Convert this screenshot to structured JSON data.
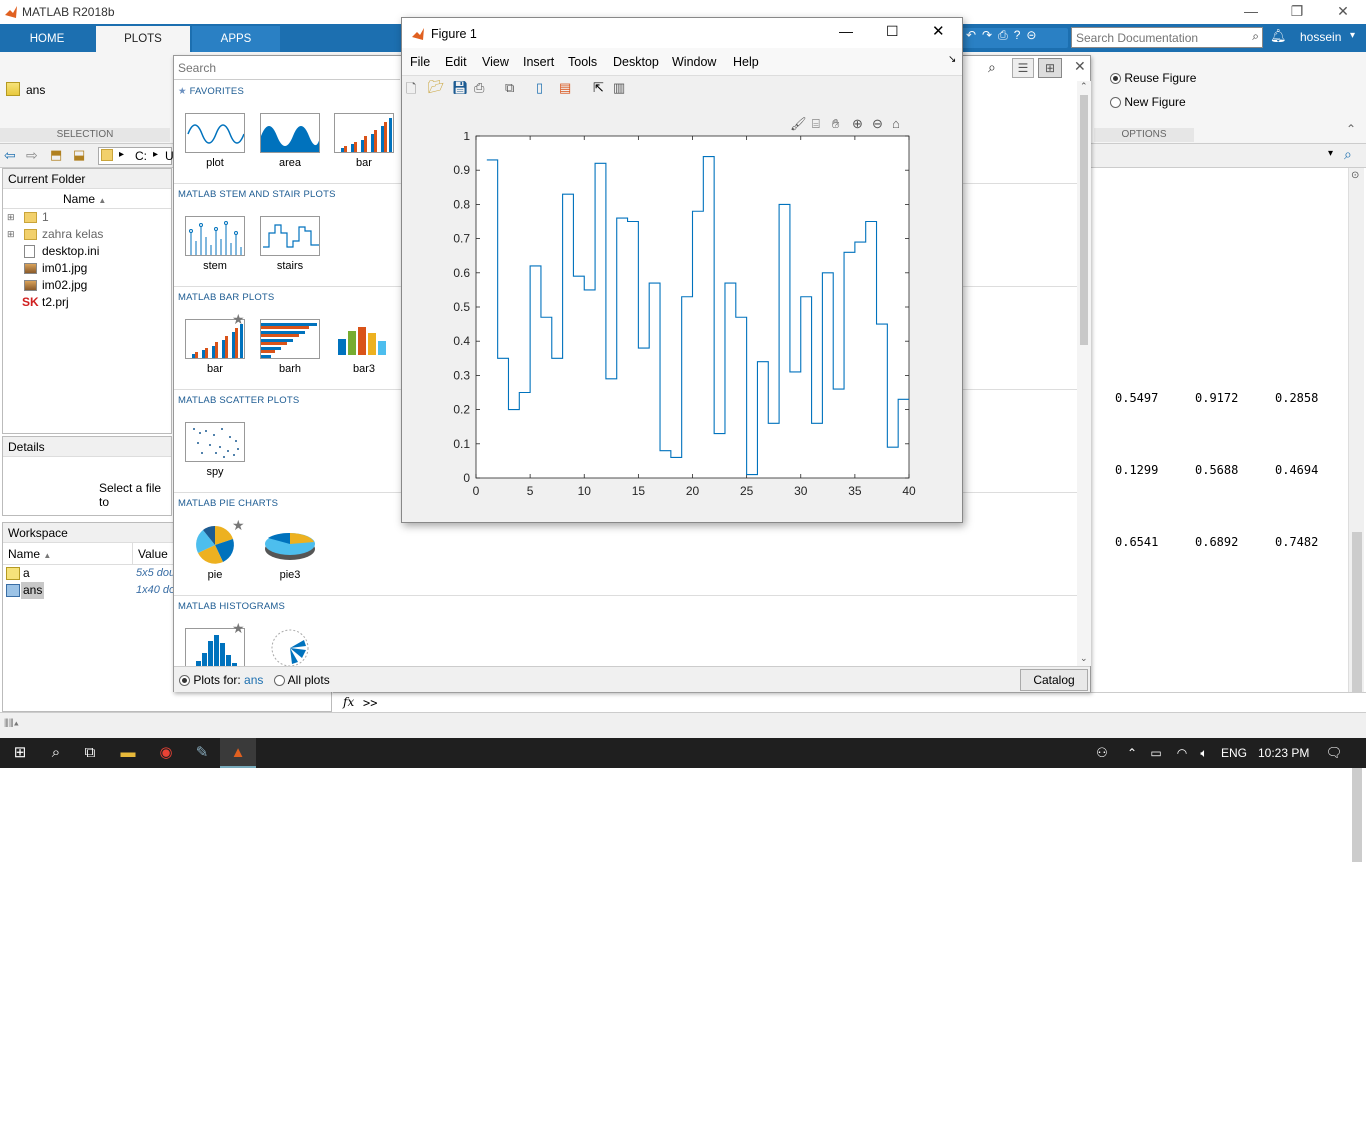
{
  "app": {
    "title": "MATLAB R2018b"
  },
  "tabs": [
    "HOME",
    "PLOTS",
    "APPS"
  ],
  "ribbon": {
    "selection_var": "ans",
    "selection_label": "SELECTION",
    "options_label": "OPTIONS",
    "reuse_figure": "Reuse Figure",
    "new_figure": "New Figure",
    "search_placeholder": "Search Documentation",
    "user": "hossein"
  },
  "path": {
    "drive": "C:",
    "rest": "U"
  },
  "current_folder": {
    "title": "Current Folder",
    "column": "Name",
    "items": [
      "1",
      "zahra kelas",
      "desktop.ini",
      "im01.jpg",
      "im02.jpg",
      "t2.prj"
    ]
  },
  "details": {
    "title": "Details",
    "text": "Select a file to"
  },
  "workspace": {
    "title": "Workspace",
    "col_name": "Name",
    "col_value": "Value",
    "rows": [
      {
        "name": "a",
        "value": "5x5 dou"
      },
      {
        "name": "ans",
        "value": "1x40 do"
      }
    ]
  },
  "gallery": {
    "search_placeholder": "Search",
    "favorites_label": "FAVORITES",
    "sections": [
      {
        "title": "MATLAB STEM AND STAIR PLOTS",
        "items": [
          "stem",
          "stairs"
        ]
      },
      {
        "title": "MATLAB BAR PLOTS",
        "items": [
          "bar",
          "barh",
          "bar3"
        ]
      },
      {
        "title": "MATLAB SCATTER PLOTS",
        "items": [
          "spy"
        ]
      },
      {
        "title": "MATLAB PIE CHARTS",
        "items": [
          "pie",
          "pie3"
        ]
      },
      {
        "title": "MATLAB HISTOGRAMS",
        "items": [
          "",
          ""
        ]
      }
    ],
    "favorites": [
      "plot",
      "area",
      "bar"
    ],
    "plots_for_label": "Plots for:",
    "plots_for_var": "ans",
    "all_plots": "All plots",
    "catalog": "Catalog"
  },
  "command_window": {
    "rows": [
      [
        "0.5497",
        "0.9172",
        "0.2858"
      ],
      [
        "0.1299",
        "0.5688",
        "0.4694"
      ],
      [
        "0.6541",
        "0.6892",
        "0.7482"
      ]
    ],
    "prompt": ">>",
    "fx": "fx"
  },
  "figure": {
    "title": "Figure 1",
    "menu": [
      "File",
      "Edit",
      "View",
      "Insert",
      "Tools",
      "Desktop",
      "Window",
      "Help"
    ]
  },
  "chart_data": {
    "type": "line",
    "style": "stairs",
    "x": [
      1,
      2,
      3,
      4,
      5,
      6,
      7,
      8,
      9,
      10,
      11,
      12,
      13,
      14,
      15,
      16,
      17,
      18,
      19,
      20,
      21,
      22,
      23,
      24,
      25,
      26,
      27,
      28,
      29,
      30,
      31,
      32,
      33,
      34,
      35,
      36,
      37,
      38,
      39,
      40
    ],
    "y": [
      0.93,
      0.35,
      0.2,
      0.25,
      0.62,
      0.47,
      0.35,
      0.83,
      0.59,
      0.55,
      0.92,
      0.29,
      0.76,
      0.75,
      0.38,
      0.57,
      0.08,
      0.06,
      0.53,
      0.78,
      0.94,
      0.13,
      0.57,
      0.47,
      0.01,
      0.34,
      0.16,
      0.8,
      0.31,
      0.53,
      0.16,
      0.6,
      0.26,
      0.66,
      0.69,
      0.75,
      0.45,
      0.09,
      0.23,
      0.23
    ],
    "xlim": [
      0,
      40
    ],
    "ylim": [
      0,
      1
    ],
    "xticks": [
      "0",
      "5",
      "10",
      "15",
      "20",
      "25",
      "30",
      "35",
      "40"
    ],
    "yticks": [
      "0",
      "0.1",
      "0.2",
      "0.3",
      "0.4",
      "0.5",
      "0.6",
      "0.7",
      "0.8",
      "0.9",
      "1"
    ],
    "color": "#0072bd",
    "title": "",
    "xlabel": "",
    "ylabel": ""
  },
  "taskbar": {
    "lang": "ENG",
    "time": "10:23 PM"
  }
}
